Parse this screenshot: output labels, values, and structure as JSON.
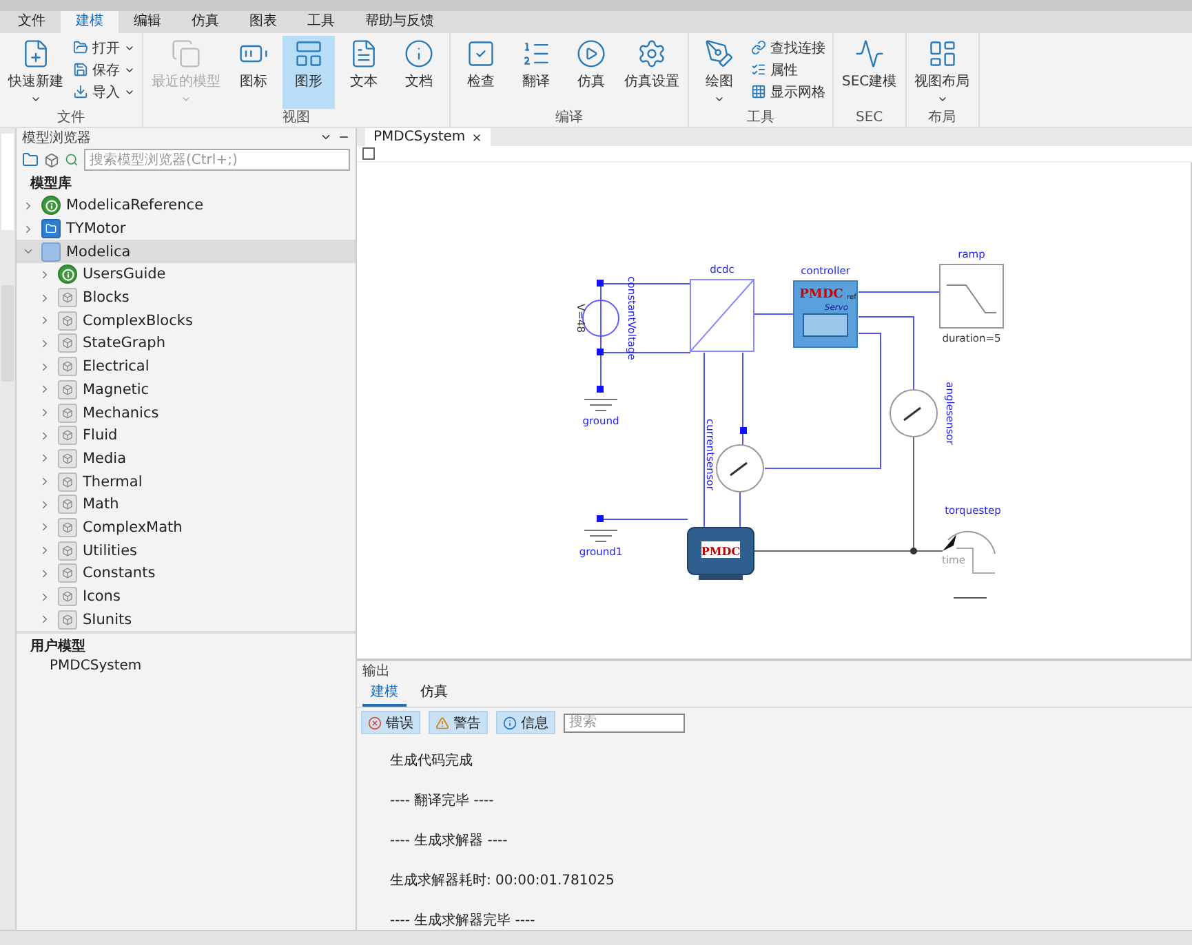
{
  "menu": [
    {
      "label": "文件",
      "selected": false
    },
    {
      "label": "建模",
      "selected": true
    },
    {
      "label": "编辑",
      "selected": false
    },
    {
      "label": "仿真",
      "selected": false
    },
    {
      "label": "图表",
      "selected": false
    },
    {
      "label": "工具",
      "selected": false
    },
    {
      "label": "帮助与反馈",
      "selected": false
    }
  ],
  "ribbon": [
    {
      "label": "文件",
      "buttons": [
        {
          "label": "快速新建",
          "kind": "large",
          "dropdown": true,
          "disabled": false,
          "selected": false
        },
        {
          "label": "打开",
          "kind": "small",
          "dropdown": true,
          "disabled": false,
          "selected": false
        },
        {
          "label": "保存",
          "kind": "small",
          "dropdown": true,
          "disabled": false,
          "selected": false
        },
        {
          "label": "导入",
          "kind": "small",
          "dropdown": true,
          "disabled": false,
          "selected": false
        }
      ]
    },
    {
      "label": "视图",
      "buttons": [
        {
          "label": "最近的模型",
          "kind": "large",
          "dropdown": true,
          "disabled": true,
          "selected": false
        },
        {
          "label": "图标",
          "kind": "large",
          "dropdown": false,
          "disabled": false,
          "selected": false
        },
        {
          "label": "图形",
          "kind": "large",
          "dropdown": false,
          "disabled": false,
          "selected": true
        },
        {
          "label": "文本",
          "kind": "large",
          "dropdown": false,
          "disabled": false,
          "selected": false
        },
        {
          "label": "文档",
          "kind": "large",
          "dropdown": false,
          "disabled": false,
          "selected": false
        }
      ]
    },
    {
      "label": "编译",
      "buttons": [
        {
          "label": "检查",
          "kind": "large",
          "dropdown": false,
          "disabled": false,
          "selected": false
        },
        {
          "label": "翻译",
          "kind": "large",
          "dropdown": false,
          "disabled": false,
          "selected": false
        },
        {
          "label": "仿真",
          "kind": "large",
          "dropdown": false,
          "disabled": false,
          "selected": false
        },
        {
          "label": "仿真设置",
          "kind": "large",
          "dropdown": false,
          "disabled": false,
          "selected": false
        }
      ]
    },
    {
      "label": "工具",
      "buttons": [
        {
          "label": "绘图",
          "kind": "large",
          "dropdown": true,
          "disabled": false,
          "selected": false
        },
        {
          "label": "查找连接",
          "kind": "small",
          "dropdown": false,
          "disabled": false,
          "selected": false
        },
        {
          "label": "属性",
          "kind": "small",
          "dropdown": false,
          "disabled": false,
          "selected": false
        },
        {
          "label": "显示网格",
          "kind": "small",
          "dropdown": false,
          "disabled": false,
          "selected": false
        }
      ]
    },
    {
      "label": "SEC",
      "buttons": [
        {
          "label": "SEC建模",
          "kind": "large",
          "dropdown": false,
          "disabled": false,
          "selected": false
        }
      ]
    },
    {
      "label": "布局",
      "buttons": [
        {
          "label": "视图布局",
          "kind": "large",
          "dropdown": true,
          "disabled": false,
          "selected": false
        }
      ]
    }
  ],
  "browser": {
    "title": "模型浏览器",
    "search": {
      "placeholder": "搜索模型浏览器(Ctrl+;)"
    },
    "library": {
      "label": "模型库",
      "items": [
        {
          "label": "ModelicaReference",
          "kind": "info",
          "expanded": false,
          "selected": false
        },
        {
          "label": "TYMotor",
          "kind": "package",
          "expanded": false,
          "selected": false
        },
        {
          "label": "Modelica",
          "kind": "library",
          "expanded": true,
          "selected": true,
          "children": [
            {
              "label": "UsersGuide",
              "kind": "info",
              "expanded": false,
              "selected": false
            },
            {
              "label": "Blocks",
              "kind": "block",
              "expanded": false,
              "selected": false
            },
            {
              "label": "ComplexBlocks",
              "kind": "block",
              "expanded": false,
              "selected": false
            },
            {
              "label": "StateGraph",
              "kind": "block",
              "expanded": false,
              "selected": false
            },
            {
              "label": "Electrical",
              "kind": "block",
              "expanded": false,
              "selected": false
            },
            {
              "label": "Magnetic",
              "kind": "block",
              "expanded": false,
              "selected": false
            },
            {
              "label": "Mechanics",
              "kind": "block",
              "expanded": false,
              "selected": false
            },
            {
              "label": "Fluid",
              "kind": "block",
              "expanded": false,
              "selected": false
            },
            {
              "label": "Media",
              "kind": "block",
              "expanded": false,
              "selected": false
            },
            {
              "label": "Thermal",
              "kind": "block",
              "expanded": false,
              "selected": false
            },
            {
              "label": "Math",
              "kind": "block",
              "expanded": false,
              "selected": false
            },
            {
              "label": "ComplexMath",
              "kind": "block",
              "expanded": false,
              "selected": false
            },
            {
              "label": "Utilities",
              "kind": "block",
              "expanded": false,
              "selected": false
            },
            {
              "label": "Constants",
              "kind": "block",
              "expanded": false,
              "selected": false
            },
            {
              "label": "Icons",
              "kind": "block",
              "expanded": false,
              "selected": false
            },
            {
              "label": "SIunits",
              "kind": "block",
              "expanded": false,
              "selected": false
            }
          ]
        }
      ]
    },
    "user_models": {
      "label": "用户模型",
      "items": [
        {
          "label": "PMDCSystem",
          "selected": false
        }
      ]
    }
  },
  "editor": {
    "tabs": [
      {
        "label": "PMDCSystem",
        "selected": true
      }
    ],
    "diagram": [
      {
        "kind": "voltage-source",
        "name": "constantVoltage",
        "parameter": "V=48"
      },
      {
        "kind": "ground",
        "name": "ground"
      },
      {
        "kind": "converter",
        "name": "dcdc"
      },
      {
        "kind": "controller",
        "name": "controller",
        "badge": "PMDC",
        "subtitle": "Servo",
        "port": "ref"
      },
      {
        "kind": "ramp",
        "name": "ramp",
        "parameter": "duration=5"
      },
      {
        "kind": "sensor",
        "name": "currentsensor"
      },
      {
        "kind": "sensor",
        "name": "anglesensor"
      },
      {
        "kind": "motor",
        "badge": "PMDC"
      },
      {
        "kind": "ground",
        "name": "ground1"
      },
      {
        "kind": "torque-step",
        "name": "torquestep",
        "axis": "time"
      }
    ]
  },
  "output": {
    "title": "输出",
    "tabs": [
      {
        "label": "建模",
        "selected": true
      },
      {
        "label": "仿真",
        "selected": false
      }
    ],
    "filters": [
      {
        "label": "错误",
        "kind": "error",
        "on": true
      },
      {
        "label": "警告",
        "kind": "warning",
        "on": true
      },
      {
        "label": "信息",
        "kind": "info",
        "on": true
      }
    ],
    "search": {
      "placeholder": "搜索"
    },
    "lines": [
      "生成代码完成",
      "---- 翻译完毕 ----",
      "---- 生成求解器 ----",
      "生成求解器耗时: 00:00:01.781025",
      "---- 生成求解器完毕 ----"
    ]
  }
}
